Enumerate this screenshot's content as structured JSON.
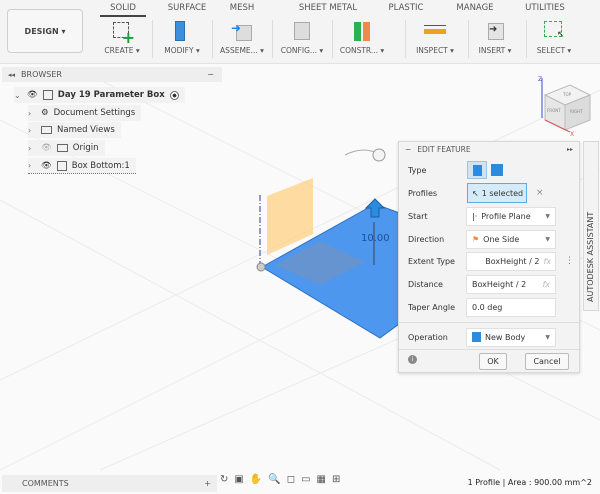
{
  "toolbar": {
    "workspace": "DESIGN ▾",
    "tabs": [
      "SOLID",
      "SURFACE",
      "MESH",
      "SHEET METAL",
      "PLASTIC",
      "MANAGE",
      "UTILITIES"
    ],
    "groups": [
      "CREATE ▾",
      "MODIFY ▾",
      "ASSEME... ▾",
      "CONFIG... ▾",
      "CONSTR... ▾",
      "INSPECT ▾",
      "INSERT ▾",
      "SELECT ▾"
    ]
  },
  "browser": {
    "title": "BROWSER",
    "items": [
      {
        "label": "Day 19 Parameter Box"
      },
      {
        "label": "Document Settings"
      },
      {
        "label": "Named Views"
      },
      {
        "label": "Origin"
      },
      {
        "label": "Box Bottom:1"
      }
    ]
  },
  "viewcube": {
    "top": "TOP",
    "front": "FRONT",
    "right": "RIGHT",
    "z": "Z",
    "x": "X"
  },
  "canvas": {
    "dimension": "10.00"
  },
  "edit_feature": {
    "title": "EDIT FEATURE",
    "rows": {
      "type": "Type",
      "profiles": "Profiles",
      "profiles_value": "1 selected",
      "clear": "×",
      "start": "Start",
      "start_value": "Profile Plane",
      "direction": "Direction",
      "direction_value": "One Side",
      "extent": "Extent Type",
      "extent_value": "BoxHeight / 2",
      "distance": "Distance",
      "distance_value": "BoxHeight / 2",
      "taper": "Taper Angle",
      "taper_value": "0.0 deg",
      "operation": "Operation",
      "operation_value": "New Body"
    },
    "fx": "fx",
    "ok": "OK",
    "cancel": "Cancel"
  },
  "assistant": "AUTODESK ASSISTANT",
  "comments": "COMMENTS",
  "status": "1 Profile | Area : 900.00 mm^2"
}
